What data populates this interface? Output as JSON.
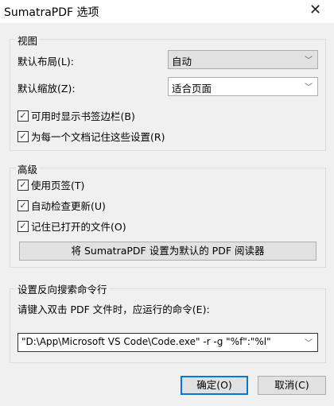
{
  "window": {
    "title": "SumatraPDF 选项",
    "close": "✕"
  },
  "view": {
    "legend": "视图",
    "layout_label": "默认布局(L):",
    "layout_value": "自动",
    "zoom_label": "默认缩放(Z):",
    "zoom_value": "适合页面",
    "cb_bookmarks": "可用时显示书签边栏(B)",
    "cb_remember": "为每一个文档记住这些设置(R)"
  },
  "advanced": {
    "legend": "高级",
    "cb_tabs": "使用页签(T)",
    "cb_updates": "自动检查更新(U)",
    "cb_open": "记住已打开的文件(O)",
    "default_button": "将 SumatraPDF 设置为默认的 PDF 阅读器"
  },
  "inverse": {
    "legend": "设置反向搜索命令行",
    "label": "请键入双击 PDF 文件时，应运行的命令(E):",
    "value": "\"D:\\App\\Microsoft VS Code\\Code.exe\" -r -g \"%f\":\"%l\""
  },
  "buttons": {
    "ok": "确定(O)",
    "cancel": "取消(C)"
  },
  "check": "✓",
  "chevron": "﹀"
}
